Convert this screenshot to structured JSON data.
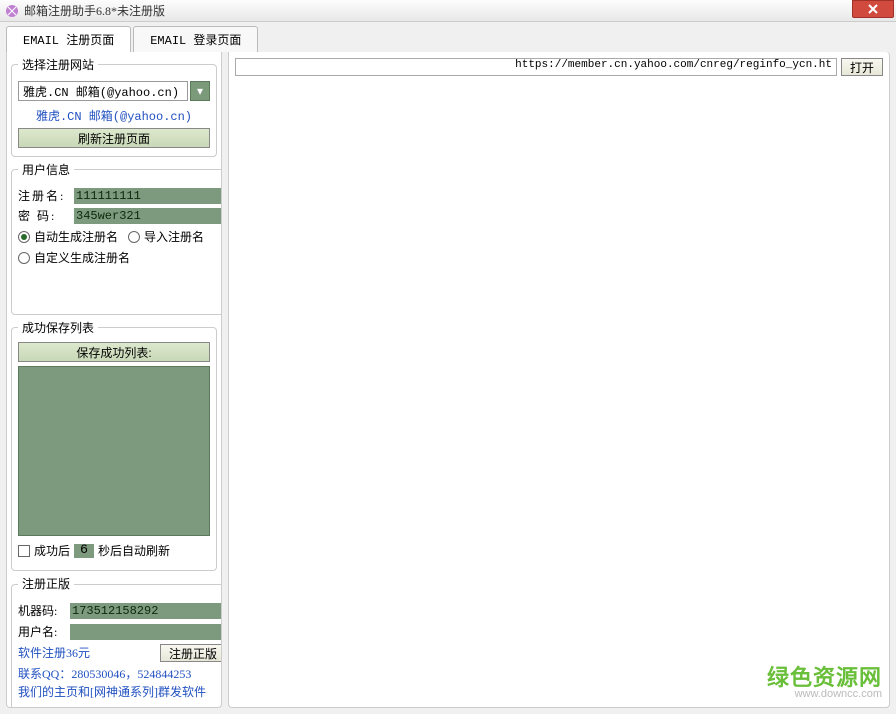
{
  "window": {
    "title": "邮箱注册助手6.8*未注册版"
  },
  "tabs": {
    "register": "EMAIL 注册页面",
    "login": "EMAIL 登录页面"
  },
  "site_select": {
    "legend": "选择注册网站",
    "selected": "雅虎.CN 邮箱(@yahoo.cn)",
    "link": "雅虎.CN 邮箱(@yahoo.cn)",
    "refresh_btn": "刷新注册页面"
  },
  "user_info": {
    "legend": "用户信息",
    "reg_name_label": "注册名:",
    "reg_name_value": "111111111",
    "pwd_label": "密  码:",
    "pwd_value": "345wer321",
    "radio_auto": "自动生成注册名",
    "radio_import": "导入注册名",
    "radio_custom": "自定义生成注册名"
  },
  "save_list": {
    "legend": "成功保存列表",
    "header_btn": "保存成功列表:",
    "after_success": "成功后",
    "seconds": "6",
    "auto_refresh": "秒后自动刷新"
  },
  "register": {
    "legend": "注册正版",
    "machine_code_label": "机器码:",
    "machine_code": "173512158292",
    "username_label": "用户名:",
    "username": "",
    "btn": "注册正版",
    "fee": "软件注册36元",
    "contact": "联系QQ：280530046，524844253",
    "homepage": "我们的主页和[网神通系列]群发软件"
  },
  "browser": {
    "url": "https://member.cn.yahoo.com/cnreg/reginfo_ycn.ht",
    "open_btn": "打开"
  },
  "watermark": {
    "line1": "绿色资源网",
    "line2": "www.downcc.com"
  }
}
